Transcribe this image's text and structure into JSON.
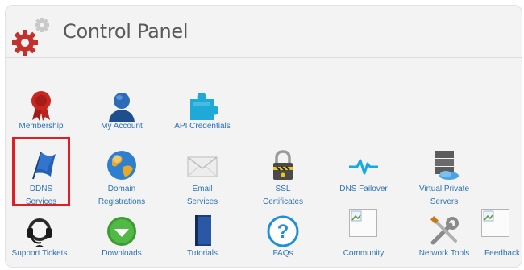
{
  "header": {
    "title": "Control Panel",
    "icon": "gears-icon"
  },
  "colors": {
    "link": "#2c72b5",
    "highlight": "#e21e25",
    "panel_bg": "#f3f3f3"
  },
  "rows": [
    [
      {
        "label": "Membership",
        "icon": "ribbon-icon"
      },
      {
        "label": "My Account",
        "icon": "user-icon"
      },
      {
        "label": "API Credentials",
        "icon": "puzzle-icon"
      }
    ],
    [
      {
        "label": "DDNS\nServices",
        "icon": "flag-icon",
        "highlighted": true
      },
      {
        "label": "Domain\nRegistrations",
        "icon": "globe-icon"
      },
      {
        "label": "Email\nServices",
        "icon": "envelope-icon"
      },
      {
        "label": "SSL\nCertificates",
        "icon": "lock-icon"
      },
      {
        "label": "DNS Failover",
        "icon": "pulse-icon"
      },
      {
        "label": "Virtual Private\nServers",
        "icon": "servers-icon"
      }
    ],
    [
      {
        "label": "Support Tickets",
        "icon": "headset-icon"
      },
      {
        "label": "Downloads",
        "icon": "download-icon"
      },
      {
        "label": "Tutorials",
        "icon": "book-icon"
      },
      {
        "label": "FAQs",
        "icon": "question-icon"
      },
      {
        "label": "Community",
        "icon": "broken-image-icon"
      },
      {
        "label": "Network Tools",
        "icon": "tools-icon"
      },
      {
        "label": "Feedback",
        "icon": "broken-image-icon"
      }
    ]
  ]
}
